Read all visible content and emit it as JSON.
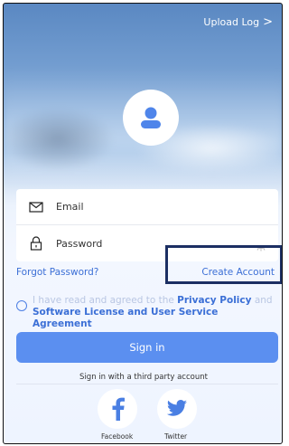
{
  "header": {
    "upload_log": "Upload Log",
    "chevron": ">"
  },
  "login": {
    "email_placeholder": "Email",
    "password_placeholder": "Password"
  },
  "links": {
    "forgot_password": "Forgot Password?",
    "create_account": "Create Account"
  },
  "agreement": {
    "prefix": "I have read and agreed to the ",
    "privacy_policy": "Privacy Policy",
    "and": " and ",
    "software_license": "Software License and User Service Agreement"
  },
  "actions": {
    "sign_in": "Sign in"
  },
  "third_party": {
    "caption": "Sign in with a third party account",
    "facebook": "Facebook",
    "twitter": "Twitter"
  },
  "colors": {
    "primary": "#5b8ff0",
    "link": "#3b6fd6",
    "highlight_box": "#1c2f63"
  },
  "icons": [
    "chevron-right-icon",
    "user-avatar-icon",
    "mail-icon",
    "lock-icon",
    "eye-hidden-icon",
    "facebook-icon",
    "twitter-icon"
  ]
}
